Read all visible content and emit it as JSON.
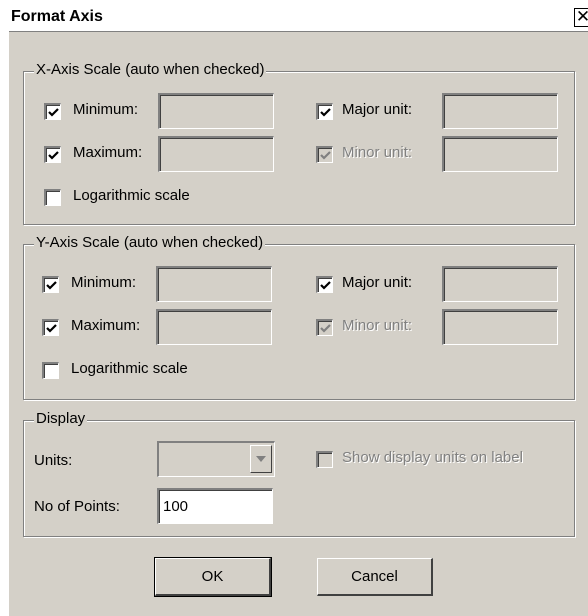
{
  "dialog": {
    "title": "Format Axis",
    "close_glyph": "✕"
  },
  "x_axis": {
    "legend": "X-Axis Scale (auto when checked)",
    "minimum": {
      "label": "Minimum:",
      "checked": true,
      "value": ""
    },
    "maximum": {
      "label": "Maximum:",
      "checked": true,
      "value": ""
    },
    "major_unit": {
      "label": "Major unit:",
      "checked": true,
      "value": ""
    },
    "minor_unit": {
      "label": "Minor unit:",
      "checked": true,
      "disabled": true,
      "value": ""
    },
    "logarithmic": {
      "label": "Logarithmic scale",
      "checked": false
    }
  },
  "y_axis": {
    "legend": "Y-Axis Scale (auto when checked)",
    "minimum": {
      "label": "Minimum:",
      "checked": true,
      "value": ""
    },
    "maximum": {
      "label": "Maximum:",
      "checked": true,
      "value": ""
    },
    "major_unit": {
      "label": "Major unit:",
      "checked": true,
      "value": ""
    },
    "minor_unit": {
      "label": "Minor unit:",
      "checked": true,
      "disabled": true,
      "value": ""
    },
    "logarithmic": {
      "label": "Logarithmic scale",
      "checked": false
    }
  },
  "display": {
    "legend": "Display",
    "units_label": "Units:",
    "units_value": "",
    "show_units": {
      "label": "Show display units on label",
      "checked": false,
      "disabled": true
    },
    "points_label": "No of Points:",
    "points_value": "100"
  },
  "buttons": {
    "ok": "OK",
    "cancel": "Cancel"
  },
  "icons": {
    "close": "close-icon",
    "check": "checkmark-icon",
    "dropdown": "chevron-down-icon"
  }
}
